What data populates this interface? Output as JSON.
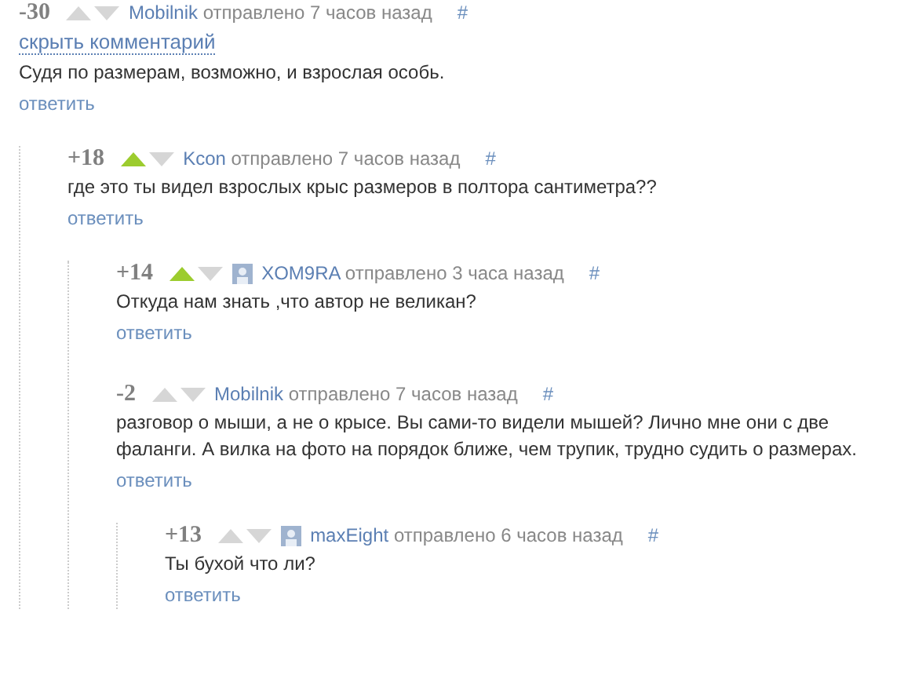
{
  "comments": [
    {
      "score": "-30",
      "voted_up": false,
      "author": "Mobilnik",
      "has_avatar": false,
      "time": "отправлено 7 часов назад",
      "anchor": "#",
      "hide_link": "скрыть комментарий",
      "text": "Судя по размерам, возможно, и взрослая особь.",
      "reply": "ответить",
      "children": [
        {
          "score": "+18",
          "voted_up": true,
          "author": "Kcon",
          "has_avatar": false,
          "time": "отправлено 7 часов назад",
          "anchor": "#",
          "text": "где это ты видел взрослых крыс размеров в полтора сантиметра??",
          "reply": "ответить",
          "children": [
            {
              "score": "+14",
              "voted_up": true,
              "author": "XOM9RA",
              "has_avatar": true,
              "time": "отправлено 3 часа назад",
              "anchor": "#",
              "text": "Откуда нам знать ,что автор не великан?",
              "reply": "ответить"
            },
            {
              "score": "-2",
              "voted_up": false,
              "author": "Mobilnik",
              "has_avatar": false,
              "time": "отправлено 7 часов назад",
              "anchor": "#",
              "text": "разговор о мыши, а не о крысе. Вы сами-то видели мышей? Лично мне они с две фаланги. А вилка на фото на порядок ближе, чем трупик, трудно судить о размерах.",
              "reply": "ответить",
              "children": [
                {
                  "score": "+13",
                  "voted_up": false,
                  "author": "maxEight",
                  "has_avatar": true,
                  "time": "отправлено 6 часов назад",
                  "anchor": "#",
                  "text": "Ты бухой что ли?",
                  "reply": "ответить"
                }
              ]
            }
          ]
        }
      ]
    }
  ]
}
